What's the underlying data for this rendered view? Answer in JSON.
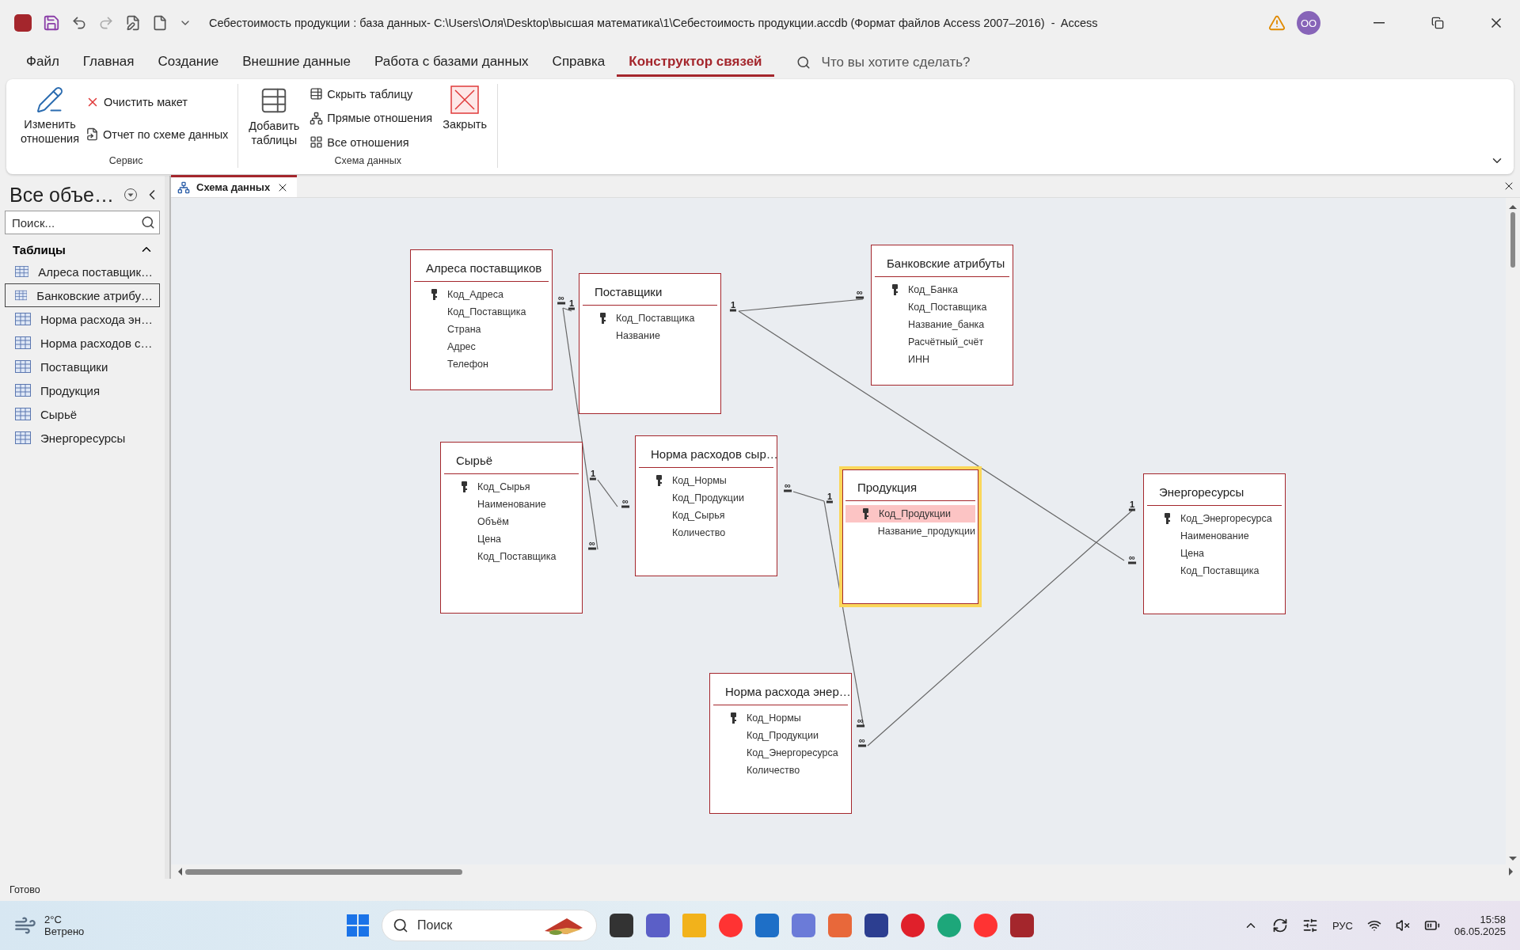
{
  "window": {
    "title": "Себестоимость продукции : база данных- C:\\Users\\Оля\\Desktop\\высшая математика\\1\\Себестоимость продукции.accdb (Формат файлов Access 2007–2016)  -  Access",
    "account_initials": "OO"
  },
  "menu_tabs": [
    {
      "label": "Файл",
      "selected": false
    },
    {
      "label": "Главная",
      "selected": false
    },
    {
      "label": "Создание",
      "selected": false
    },
    {
      "label": "Внешние данные",
      "selected": false
    },
    {
      "label": "Работа с базами данных",
      "selected": false
    },
    {
      "label": "Справка",
      "selected": false
    },
    {
      "label": "Конструктор связей",
      "selected": true
    }
  ],
  "tell_me": {
    "placeholder": "Что вы хотите сделать?"
  },
  "ribbon": {
    "groups": [
      {
        "label": "Сервис",
        "buttons": [
          {
            "kind": "large",
            "label": "Изменить отношения"
          },
          {
            "kind": "small",
            "label": "Очистить макет"
          },
          {
            "kind": "small",
            "label": "Отчет по схеме данных"
          }
        ]
      },
      {
        "label": "Схема данных",
        "buttons": [
          {
            "kind": "large",
            "label": "Добавить таблицы"
          },
          {
            "kind": "small",
            "label": "Скрыть таблицу"
          },
          {
            "kind": "small",
            "label": "Прямые отношения"
          },
          {
            "kind": "small",
            "label": "Все отношения"
          },
          {
            "kind": "large",
            "label": "Закрыть"
          }
        ]
      }
    ]
  },
  "navigation": {
    "title": "Все объе…",
    "search": {
      "placeholder": "Поиск..."
    },
    "groups": [
      {
        "label": "Таблицы",
        "expanded": true,
        "items": [
          {
            "label": "Алреса поставщик…",
            "selected": false
          },
          {
            "label": "Банковские атрибу…",
            "selected": true
          },
          {
            "label": "Норма расхода эн…",
            "selected": false
          },
          {
            "label": "Норма расходов с…",
            "selected": false
          },
          {
            "label": "Поставщики",
            "selected": false
          },
          {
            "label": "Продукция",
            "selected": false
          },
          {
            "label": "Сырьё",
            "selected": false
          },
          {
            "label": "Энергоресурсы",
            "selected": false
          }
        ]
      }
    ]
  },
  "document_tabs": [
    {
      "label": "Схема данных",
      "selected": true
    }
  ],
  "diagram": {
    "tables": [
      {
        "title": "Алреса поставщиков",
        "selected": false,
        "fields": [
          {
            "name": "Код_Адреса",
            "primary_key": true,
            "selected": false
          },
          {
            "name": "Код_Поставщика",
            "primary_key": false,
            "selected": false
          },
          {
            "name": "Страна",
            "primary_key": false,
            "selected": false
          },
          {
            "name": "Адрес",
            "primary_key": false,
            "selected": false
          },
          {
            "name": "Телефон",
            "primary_key": false,
            "selected": false
          }
        ]
      },
      {
        "title": "Поставщики",
        "selected": false,
        "fields": [
          {
            "name": "Код_Поставщика",
            "primary_key": true,
            "selected": false
          },
          {
            "name": "Название",
            "primary_key": false,
            "selected": false
          }
        ]
      },
      {
        "title": "Банковские атрибуты",
        "selected": false,
        "fields": [
          {
            "name": "Код_Банка",
            "primary_key": true,
            "selected": false
          },
          {
            "name": "Код_Поставщика",
            "primary_key": false,
            "selected": false
          },
          {
            "name": "Название_банка",
            "primary_key": false,
            "selected": false
          },
          {
            "name": "Расчётный_счёт",
            "primary_key": false,
            "selected": false
          },
          {
            "name": "ИНН",
            "primary_key": false,
            "selected": false
          }
        ]
      },
      {
        "title": "Сырьё",
        "selected": false,
        "fields": [
          {
            "name": "Код_Сырья",
            "primary_key": true,
            "selected": false
          },
          {
            "name": "Наименование",
            "primary_key": false,
            "selected": false
          },
          {
            "name": "Объём",
            "primary_key": false,
            "selected": false
          },
          {
            "name": "Цена",
            "primary_key": false,
            "selected": false
          },
          {
            "name": "Код_Поставщика",
            "primary_key": false,
            "selected": false
          }
        ]
      },
      {
        "title": "Норма расходов сыр…",
        "selected": false,
        "fields": [
          {
            "name": "Код_Нормы",
            "primary_key": true,
            "selected": false
          },
          {
            "name": "Код_Продукции",
            "primary_key": false,
            "selected": false
          },
          {
            "name": "Код_Сырья",
            "primary_key": false,
            "selected": false
          },
          {
            "name": "Количество",
            "primary_key": false,
            "selected": false
          }
        ]
      },
      {
        "title": "Продукция",
        "selected": true,
        "fields": [
          {
            "name": "Код_Продукции",
            "primary_key": true,
            "selected": true
          },
          {
            "name": "Название_продукции",
            "primary_key": false,
            "selected": false
          }
        ]
      },
      {
        "title": "Энергоресурсы",
        "selected": false,
        "fields": [
          {
            "name": "Код_Энергоресурса",
            "primary_key": true,
            "selected": false
          },
          {
            "name": "Наименование",
            "primary_key": false,
            "selected": false
          },
          {
            "name": "Цена",
            "primary_key": false,
            "selected": false
          },
          {
            "name": "Код_Поставщика",
            "primary_key": false,
            "selected": false
          }
        ]
      },
      {
        "title": "Норма расхода энер…",
        "selected": false,
        "fields": [
          {
            "name": "Код_Нормы",
            "primary_key": true,
            "selected": false
          },
          {
            "name": "Код_Продукции",
            "primary_key": false,
            "selected": false
          },
          {
            "name": "Код_Энергоресурса",
            "primary_key": false,
            "selected": false
          },
          {
            "name": "Количество",
            "primary_key": false,
            "selected": false
          }
        ]
      }
    ],
    "relationships": [
      {
        "marks": [
          "∞",
          "1"
        ]
      },
      {
        "marks": [
          "∞"
        ]
      },
      {
        "marks": [
          "1",
          "∞"
        ]
      },
      {
        "marks": [
          "1",
          "∞"
        ]
      },
      {
        "marks": [
          "∞"
        ]
      },
      {
        "marks": [
          "∞",
          "1"
        ]
      },
      {
        "marks": [
          "∞"
        ]
      },
      {
        "marks": [
          "1",
          "∞"
        ]
      }
    ]
  },
  "status_bar": {
    "text": "Готово"
  },
  "taskbar": {
    "temperature": "2°C",
    "weather": "Ветрено",
    "search": {
      "placeholder": "Поиск"
    },
    "language": "РУС",
    "time": "15:58",
    "date": "06.05.2025"
  }
}
